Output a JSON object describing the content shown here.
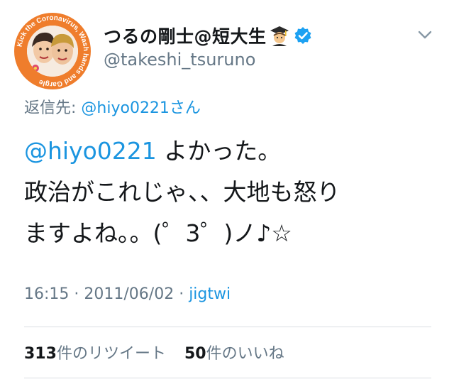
{
  "user": {
    "display_name": "つるの剛士@短大生",
    "emoji_icon": "student-emoji-icon",
    "verified_icon": "verified-badge-icon",
    "handle": "@takeshi_tsuruno",
    "avatar_ring_text": "Kick the Coronavirus, Wash hands and Gargle"
  },
  "menu_icon": "chevron-down-icon",
  "reply": {
    "prefix": "返信先: ",
    "mention": "@hiyo0221さん"
  },
  "tweet": {
    "mention": "@hiyo0221",
    "line1_rest": " よかった。",
    "line2": "政治がこれじゃ、、大地も怒り",
    "line3": "ますよね。。(゜3゜)ノ♪☆"
  },
  "meta": {
    "time": "16:15",
    "separator1": " · ",
    "date": "2011/06/02",
    "separator2": " · ",
    "source": "jigtwi"
  },
  "stats": {
    "retweets_count": "313",
    "retweets_label": "件のリツイート",
    "likes_count": "50",
    "likes_label": "件のいいね"
  },
  "colors": {
    "accent": "#1b95e0",
    "secondary_text": "#657786",
    "primary_text": "#14171a",
    "avatar_ring": "#ef7d2c"
  }
}
